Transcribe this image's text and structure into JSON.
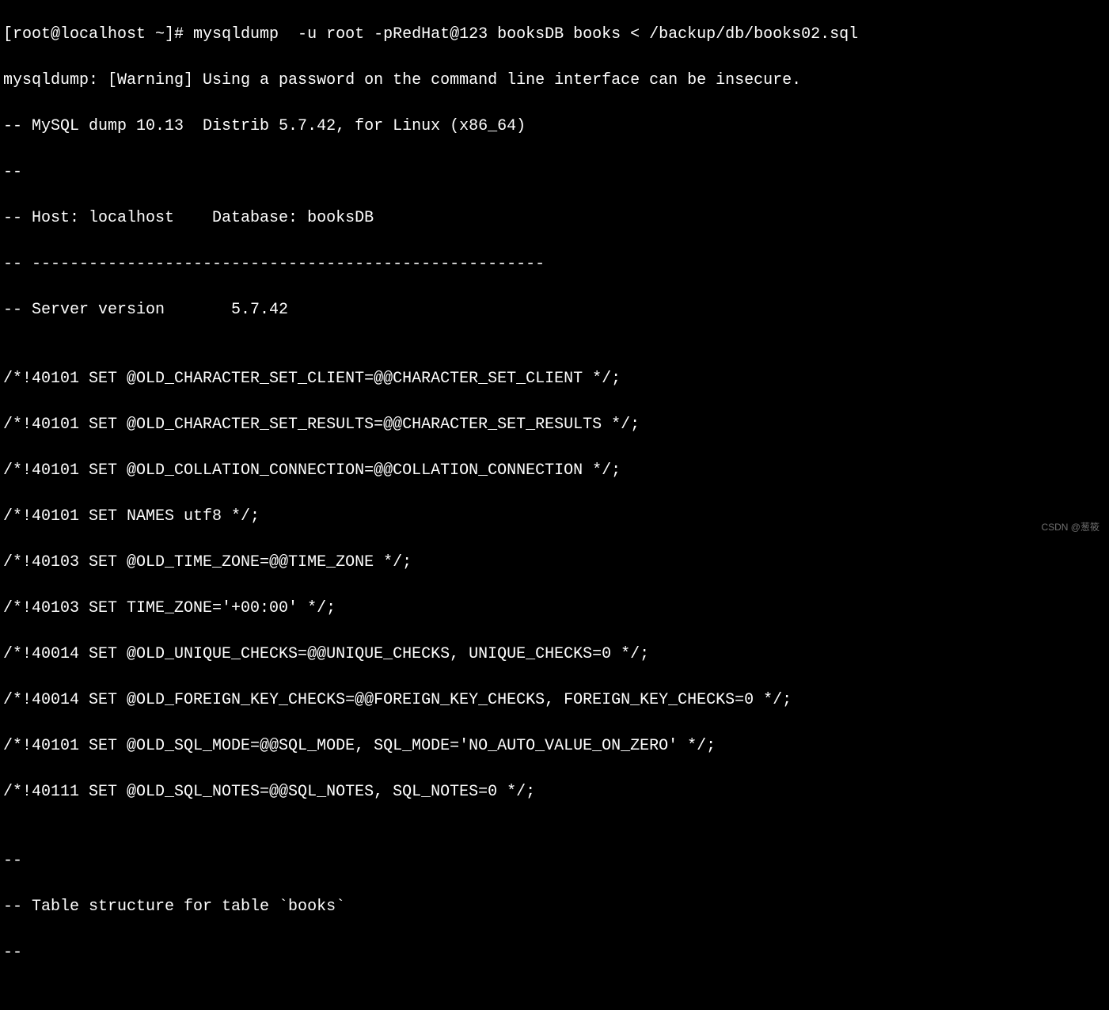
{
  "terminal": {
    "lines": [
      "[root@localhost ~]# mysqldump  -u root -pRedHat@123 booksDB books < /backup/db/books02.sql",
      "mysqldump: [Warning] Using a password on the command line interface can be insecure.",
      "-- MySQL dump 10.13  Distrib 5.7.42, for Linux (x86_64)",
      "--",
      "-- Host: localhost    Database: booksDB",
      "-- ------------------------------------------------------",
      "-- Server version       5.7.42",
      "",
      "/*!40101 SET @OLD_CHARACTER_SET_CLIENT=@@CHARACTER_SET_CLIENT */;",
      "/*!40101 SET @OLD_CHARACTER_SET_RESULTS=@@CHARACTER_SET_RESULTS */;",
      "/*!40101 SET @OLD_COLLATION_CONNECTION=@@COLLATION_CONNECTION */;",
      "/*!40101 SET NAMES utf8 */;",
      "/*!40103 SET @OLD_TIME_ZONE=@@TIME_ZONE */;",
      "/*!40103 SET TIME_ZONE='+00:00' */;",
      "/*!40014 SET @OLD_UNIQUE_CHECKS=@@UNIQUE_CHECKS, UNIQUE_CHECKS=0 */;",
      "/*!40014 SET @OLD_FOREIGN_KEY_CHECKS=@@FOREIGN_KEY_CHECKS, FOREIGN_KEY_CHECKS=0 */;",
      "/*!40101 SET @OLD_SQL_MODE=@@SQL_MODE, SQL_MODE='NO_AUTO_VALUE_ON_ZERO' */;",
      "/*!40111 SET @OLD_SQL_NOTES=@@SQL_NOTES, SQL_NOTES=0 */;",
      "",
      "--",
      "-- Table structure for table `books`",
      "--",
      ""
    ]
  },
  "watermark": "CSDN @葱筱"
}
